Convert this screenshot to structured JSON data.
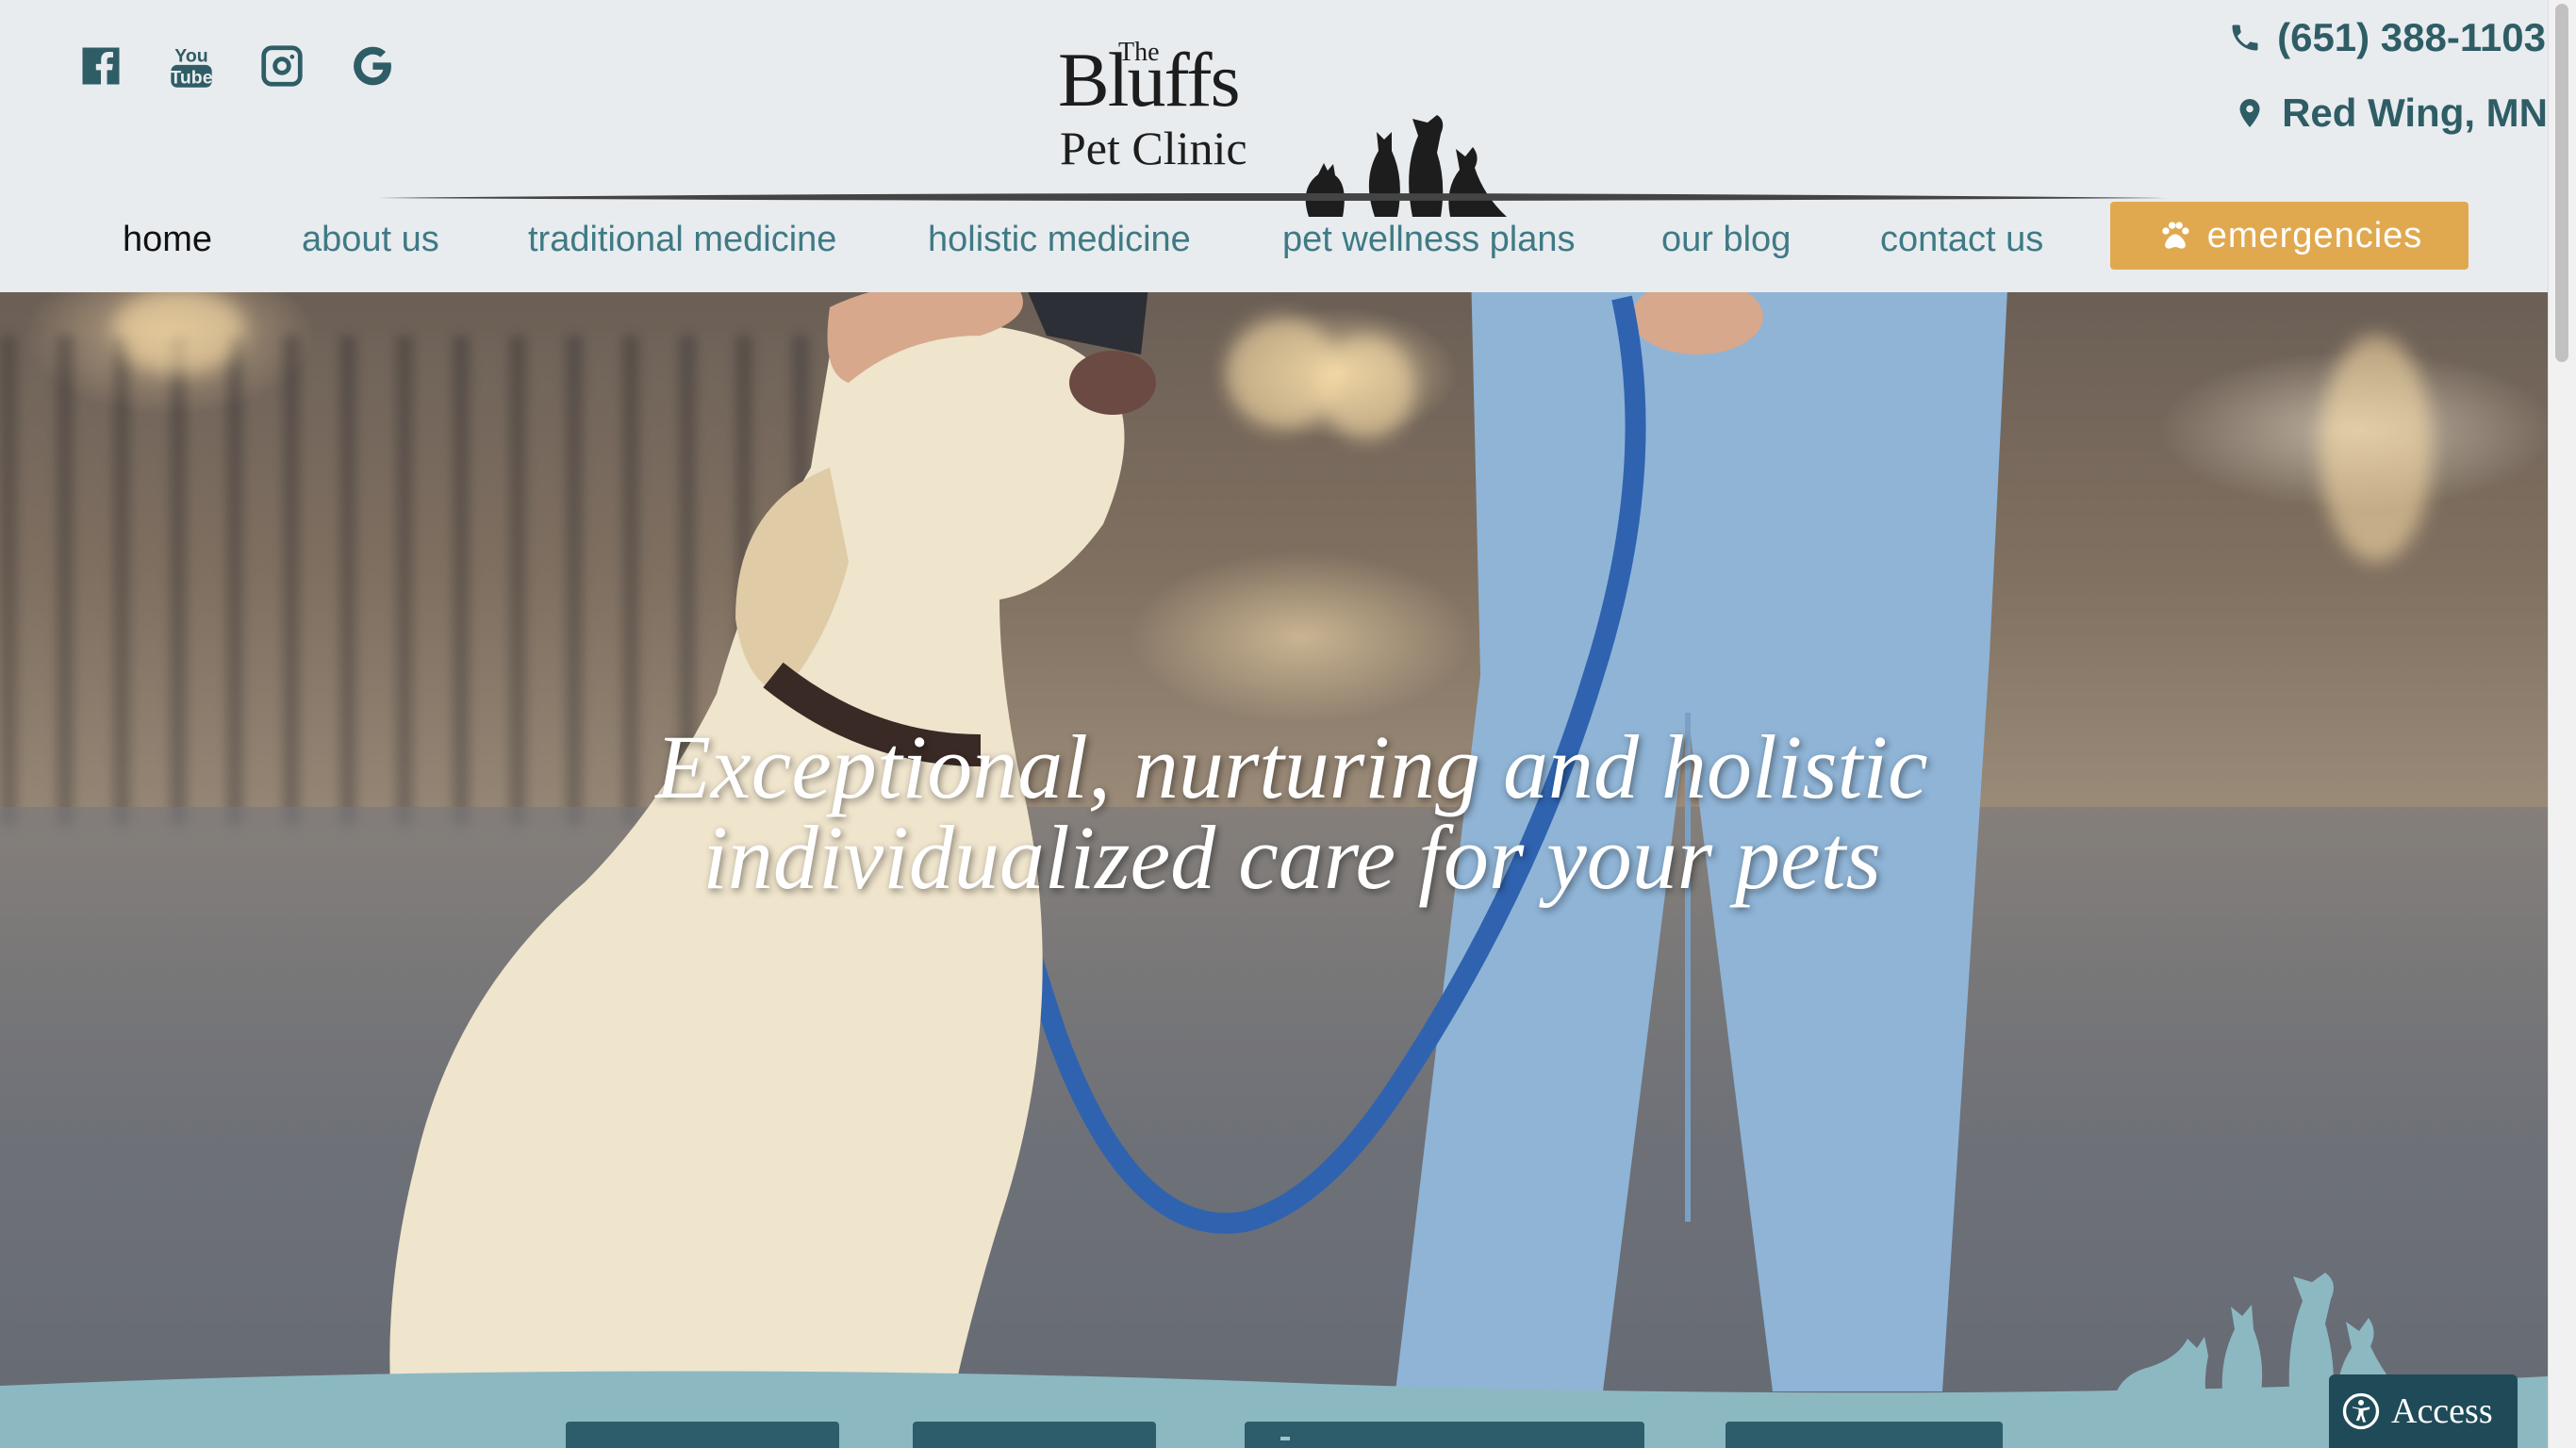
{
  "header": {
    "social": [
      {
        "name": "facebook-icon",
        "label": "Facebook"
      },
      {
        "name": "youtube-icon",
        "label": "YouTube"
      },
      {
        "name": "instagram-icon",
        "label": "Instagram"
      },
      {
        "name": "google-icon",
        "label": "Google"
      }
    ],
    "logo": {
      "the": "The",
      "bluffs": "Bluffs",
      "clinic": "Pet Clinic"
    },
    "phone": "(651) 388-1103",
    "location": "Red Wing, MN"
  },
  "nav": {
    "items": [
      {
        "label": "home",
        "active": true
      },
      {
        "label": "about us"
      },
      {
        "label": "traditional medicine"
      },
      {
        "label": "holistic medicine"
      },
      {
        "label": "pet wellness plans"
      },
      {
        "label": "our blog"
      },
      {
        "label": "contact us"
      }
    ],
    "emergency_label": "emergencies"
  },
  "hero": {
    "tagline_line1": "Exceptional, nurturing and holistic",
    "tagline_line2": "individualized care for your pets"
  },
  "accessibility": {
    "label": "Access"
  },
  "colors": {
    "accent_teal": "#3f7a85",
    "dark_teal": "#2f5d66",
    "emergency": "#e1a94f",
    "wave": "#8cb8c2",
    "access_bg": "#1f4b59"
  }
}
